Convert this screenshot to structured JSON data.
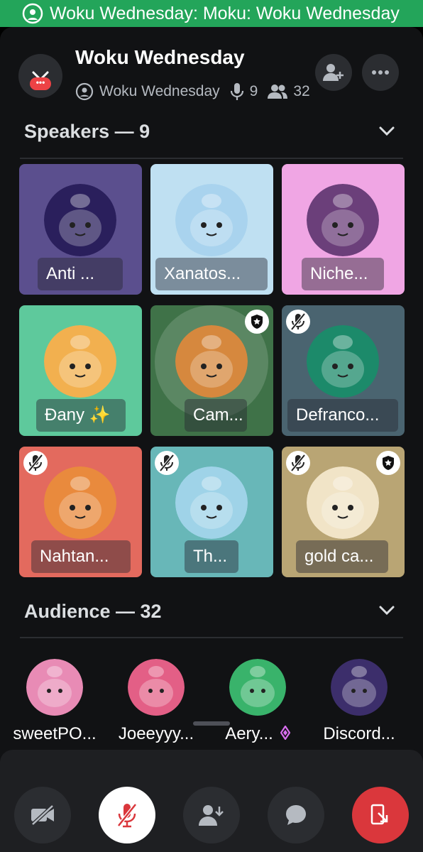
{
  "banner": {
    "text": "Woku Wednesday: Moku: Woku Wednesday",
    "icon": "stage-icon"
  },
  "header": {
    "title": "Woku Wednesday",
    "channel": "Woku Wednesday",
    "speakers_count": "9",
    "listeners_count": "32",
    "notification_badge": "•••"
  },
  "speakers": {
    "heading": "Speakers — 9",
    "tiles": [
      {
        "name": "Anti ...",
        "bg": "#5b4f8e",
        "avatar": "#2a1f5c",
        "muted": false,
        "moderator": false
      },
      {
        "name": "Xanatos...",
        "bg": "#bfe0f2",
        "avatar": "#a9d3ee",
        "muted": false,
        "moderator": false
      },
      {
        "name": "Niche...",
        "bg": "#f0a6e4",
        "avatar": "#6b3f7a",
        "muted": false,
        "moderator": false
      },
      {
        "name": "Đany ✨",
        "bg": "#5ec99c",
        "avatar": "#f2b04f",
        "muted": false,
        "moderator": false
      },
      {
        "name": "Cam...",
        "bg": "#3f7248",
        "avatar": "#d6883e",
        "muted": false,
        "moderator": true
      },
      {
        "name": "Defranco...",
        "bg": "#4a6470",
        "avatar": "#1c8a6a",
        "muted": true,
        "moderator": false
      },
      {
        "name": "Nahtan...",
        "bg": "#e36a5e",
        "avatar": "#e98a3d",
        "muted": true,
        "moderator": false
      },
      {
        "name": "Th...",
        "bg": "#68b7b8",
        "avatar": "#9fd3e8",
        "muted": true,
        "moderator": false
      },
      {
        "name": "gold ca...",
        "bg": "#b9a574",
        "avatar": "#f1e4c7",
        "muted": true,
        "moderator": true
      }
    ]
  },
  "audience": {
    "heading": "Audience — 32",
    "members": [
      {
        "name": "sweetPO...",
        "avatar": "#e88bb5"
      },
      {
        "name": "Joeeyyy...",
        "avatar": "#e35f86"
      },
      {
        "name": "Aery...",
        "avatar": "#39b36b"
      },
      {
        "name": "Discord...",
        "avatar": "#3c2e6b"
      }
    ]
  },
  "controls": {
    "buttons": [
      "camera-off",
      "mic-muted",
      "request-to-speak",
      "chat",
      "leave"
    ]
  },
  "colors": {
    "banner": "#23a55a",
    "leave": "#da373c",
    "panel": "#111214",
    "bar": "#1e1f22"
  }
}
